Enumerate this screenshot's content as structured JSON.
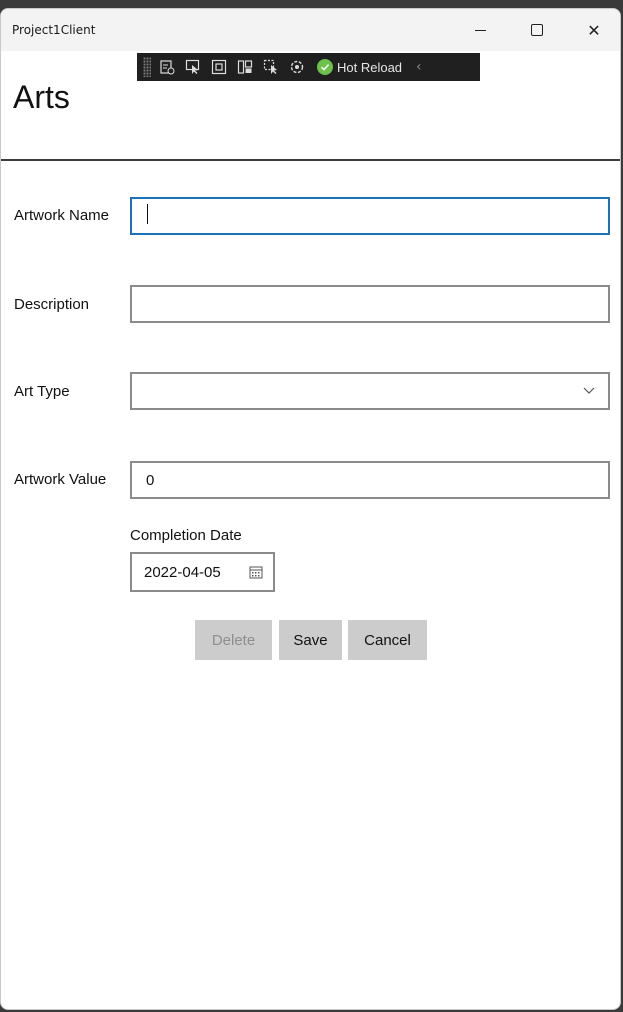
{
  "window": {
    "app_title": "Project1Client"
  },
  "hot_reload_toolbar": {
    "tools": [
      "live-visual-tree-icon",
      "select-element-icon",
      "display-layout-adorners-icon",
      "track-focused-element-icon",
      "binding-failures-icon",
      "xaml-hot-reload-settings-icon"
    ],
    "hot_reload_label": "Hot Reload"
  },
  "page": {
    "title": "Arts"
  },
  "form": {
    "artwork_name": {
      "label": "Artwork Name",
      "value": ""
    },
    "description": {
      "label": "Description",
      "value": ""
    },
    "art_type": {
      "label": "Art Type",
      "selected": ""
    },
    "artwork_value": {
      "label": "Artwork Value",
      "value": "0"
    },
    "completion_date": {
      "label": "Completion Date",
      "value": "2022-04-05"
    }
  },
  "buttons": {
    "delete": "Delete",
    "save": "Save",
    "cancel": "Cancel"
  }
}
